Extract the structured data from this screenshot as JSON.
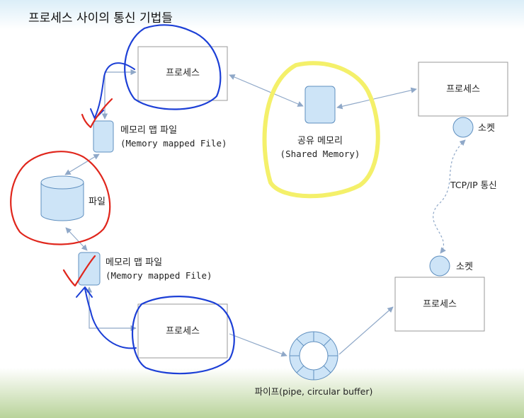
{
  "title": "프로세스 사이의 통신 기법들",
  "process_label": "프로세스",
  "mmap_label": "메모리 맵 파일",
  "mmap_sub": "(Memory mapped File)",
  "file_label": "파일",
  "shm_label": "공유 메모리",
  "shm_sub": "(Shared Memory)",
  "socket_label": "소켓",
  "tcp_label": "TCP/IP 통신",
  "pipe_label": "파이프(pipe, circular buffer)",
  "colors": {
    "box_stroke": "#9a9a9a",
    "node_fill": "#cde4f7",
    "node_stroke": "#5f8fbf",
    "arrow": "#8fa8c8",
    "pen_blue": "#1c3fd6",
    "pen_red": "#e0261c",
    "pen_yellow": "#f4f06a",
    "grass": "#b9d39a"
  }
}
